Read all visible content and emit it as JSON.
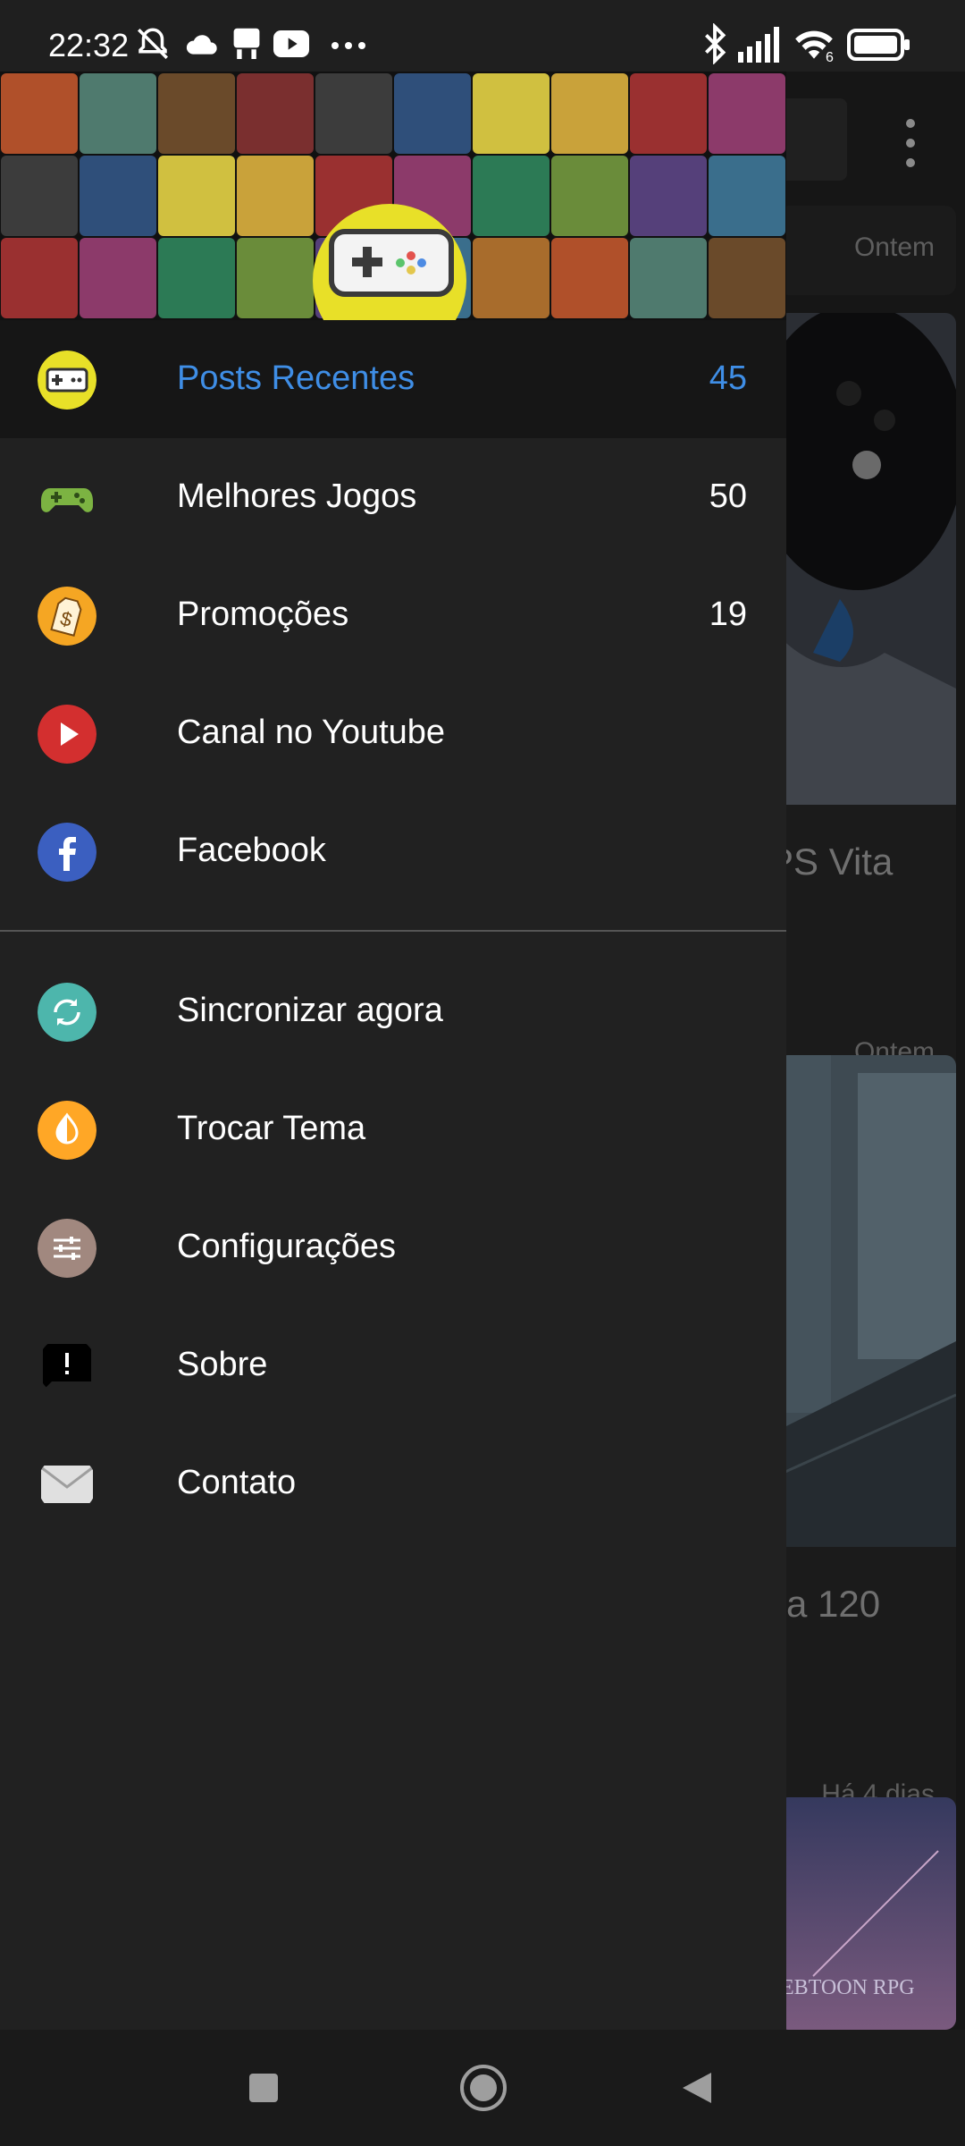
{
  "status_bar": {
    "time": "22:32",
    "icons": [
      "notifications-off-icon",
      "cloud-icon",
      "desk-icon",
      "youtube-icon",
      "more-notifications-icon",
      "bluetooth-icon",
      "signal-icon",
      "wifi-icon",
      "battery-icon"
    ],
    "wifi_badge": "6"
  },
  "background": {
    "dates": [
      "Ontem",
      "Ontem",
      "Há 4 dias"
    ],
    "titles": [
      "PS Vita",
      "a 120"
    ],
    "bottom_card_text": "EBTOON RPG"
  },
  "drawer": {
    "menu": [
      {
        "label": "Posts Recentes",
        "count": "45",
        "icon": "gamepad-icon",
        "icon_color": "#e8e028",
        "active": true
      },
      {
        "label": "Melhores Jogos",
        "count": "50",
        "icon": "game-controller-icon",
        "icon_color": "#7cb342"
      },
      {
        "label": "Promoções",
        "count": "19",
        "icon": "price-tag-icon",
        "icon_color": "#f5a623"
      },
      {
        "label": "Canal no Youtube",
        "count": "",
        "icon": "play-icon",
        "icon_color": "#d32f2f"
      },
      {
        "label": "Facebook",
        "count": "",
        "icon": "facebook-icon",
        "icon_color": "#3b5fc0"
      }
    ],
    "secondary": [
      {
        "label": "Sincronizar agora",
        "icon": "sync-icon",
        "icon_color": "#4db6ac"
      },
      {
        "label": "Trocar Tema",
        "icon": "theme-icon",
        "icon_color": "#ffa726"
      },
      {
        "label": "Configurações",
        "icon": "settings-sliders-icon",
        "icon_color": "#a1887f"
      },
      {
        "label": "Sobre",
        "icon": "feedback-icon",
        "icon_color": "#000000"
      },
      {
        "label": "Contato",
        "icon": "mail-icon",
        "icon_color": "#e0e0e0"
      }
    ],
    "accent_color": "#3f8ee6"
  },
  "nav_bar": {
    "buttons": [
      "recents-button",
      "home-button",
      "back-button"
    ]
  }
}
